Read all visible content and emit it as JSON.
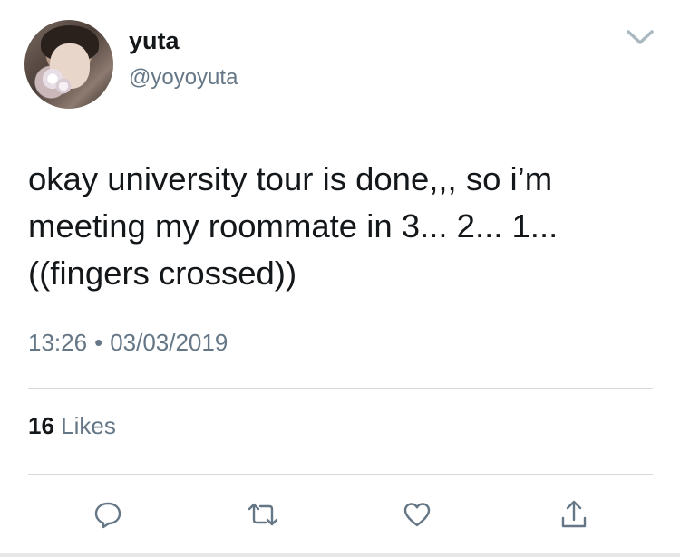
{
  "user": {
    "display_name": "yuta",
    "handle": "@yoyoyuta"
  },
  "tweet": {
    "text": "okay university tour is done,,, so i’m\nmeeting my roommate in 3... 2... 1...\n((fingers crossed))",
    "time": "13:26",
    "separator": "•",
    "date": "03/03/2019"
  },
  "stats": {
    "likes_count": "16",
    "likes_label": "Likes"
  },
  "actions": [
    "reply-icon",
    "retweet-icon",
    "like-icon",
    "share-icon"
  ],
  "colors": {
    "text_primary": "#14171a",
    "text_secondary": "#657786",
    "divider": "#d5dade"
  }
}
